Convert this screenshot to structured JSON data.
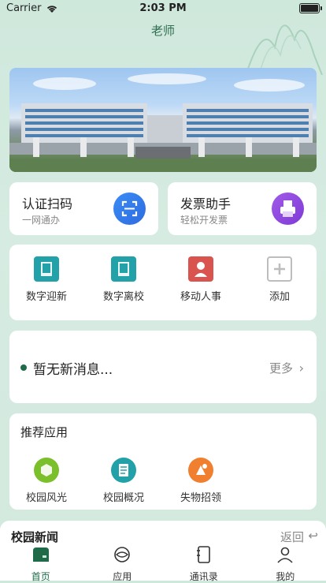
{
  "status_bar": {
    "carrier": "Carrier",
    "time": "2:03 PM"
  },
  "header": {
    "title": "老师"
  },
  "quick_actions": [
    {
      "title": "认证扫码",
      "subtitle": "一网通办",
      "icon": "scan-icon",
      "color": "#2e6be0"
    },
    {
      "title": "发票助手",
      "subtitle": "轻松开发票",
      "icon": "printer-icon",
      "color": "#7f3ad6"
    }
  ],
  "apps": [
    {
      "label": "数字迎新",
      "icon": "book-icon",
      "color": "#22a1a8"
    },
    {
      "label": "数字离校",
      "icon": "book-icon",
      "color": "#22a1a8"
    },
    {
      "label": "移动人事",
      "icon": "person-icon",
      "color": "#d9534f"
    },
    {
      "label": "添加",
      "icon": "plus-icon",
      "color": "#bdbdbd"
    }
  ],
  "notice": {
    "text": "暂无新消息...",
    "more": "更多"
  },
  "recommended": {
    "title": "推荐应用",
    "items": [
      {
        "label": "校园风光",
        "icon": "cube-icon",
        "color": "#7bbf2a"
      },
      {
        "label": "校园概况",
        "icon": "document-icon",
        "color": "#22a1a8"
      },
      {
        "label": "失物招领",
        "icon": "gift-icon",
        "color": "#f08030"
      }
    ]
  },
  "news": {
    "title": "校园新闻",
    "back": "返回"
  },
  "tabs": [
    {
      "label": "首页",
      "icon": "home-icon",
      "active": true
    },
    {
      "label": "应用",
      "icon": "app-icon",
      "active": false
    },
    {
      "label": "通讯录",
      "icon": "contacts-icon",
      "active": false
    },
    {
      "label": "我的",
      "icon": "profile-icon",
      "active": false
    }
  ]
}
